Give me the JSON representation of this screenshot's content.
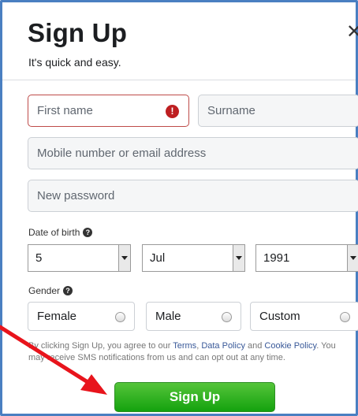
{
  "dialog": {
    "title": "Sign Up",
    "subtitle": "It's quick and easy.",
    "close_glyph": "✕"
  },
  "form": {
    "first_name": {
      "placeholder": "First name",
      "error_glyph": "!"
    },
    "surname": {
      "placeholder": "Surname"
    },
    "contact": {
      "placeholder": "Mobile number or email address"
    },
    "password": {
      "placeholder": "New password"
    },
    "dob": {
      "label": "Date of birth",
      "help_glyph": "?",
      "day": "5",
      "month": "Jul",
      "year": "1991"
    },
    "gender": {
      "label": "Gender",
      "help_glyph": "?",
      "options": [
        "Female",
        "Male",
        "Custom"
      ]
    }
  },
  "terms": {
    "prefix": "By clicking Sign Up, you agree to our ",
    "terms_link": "Terms",
    "sep1": ", ",
    "data_policy_link": "Data Policy",
    "sep2": " and ",
    "cookie_policy_link": "Cookie Policy",
    "suffix": ". You may receive SMS notifications from us and can opt out at any time."
  },
  "signup_button": "Sign Up",
  "colors": {
    "frame_border": "#4a7fc1",
    "error": "#be1f21",
    "button_green": "#14a20e",
    "link": "#385898",
    "annotation_arrow": "#e8141c"
  },
  "annotation": {
    "icon": "red-arrow-pointing-to-signup"
  }
}
